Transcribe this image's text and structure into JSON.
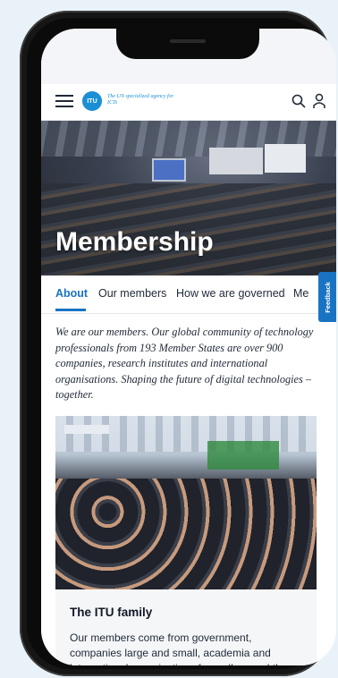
{
  "header": {
    "logo_text": "ITU",
    "tagline": "The UN specialized agency for ICTs"
  },
  "hero": {
    "title": "Membership"
  },
  "tabs": [
    {
      "label": "About",
      "active": true
    },
    {
      "label": "Our members",
      "active": false
    },
    {
      "label": "How we are governed",
      "active": false
    },
    {
      "label": "Me",
      "active": false
    }
  ],
  "feedback": {
    "label": "Feedback"
  },
  "intro": "We are our members. Our global community of technology professionals from 193 Member States are over 900 companies, research institutes and international organisations. Shaping the future of digital technologies – together.",
  "card": {
    "title": "The ITU family",
    "text": "Our members come from government, companies large and small, academia and international organisations from all around the"
  },
  "colors": {
    "accent": "#1a73c2",
    "logo": "#1a8fd6"
  }
}
